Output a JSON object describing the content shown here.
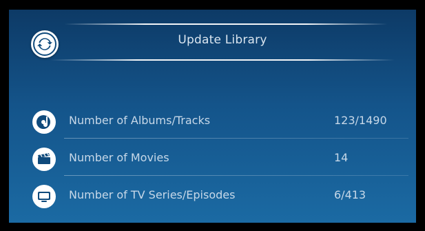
{
  "header": {
    "title": "Update Library",
    "update_icon": "refresh-icon"
  },
  "stats": [
    {
      "icon": "music-disc-icon",
      "label": "Number of Albums/Tracks",
      "value": "123/1490"
    },
    {
      "icon": "clapperboard-icon",
      "label": "Number of Movies",
      "value": "14"
    },
    {
      "icon": "tv-icon",
      "label": "Number of TV Series/Episodes",
      "value": "6/413"
    }
  ],
  "colors": {
    "background_top": "#0d3a66",
    "background_bottom": "#1b6aa3",
    "text": "#c7d8e8",
    "icon_fill": "#0f4a7c"
  }
}
